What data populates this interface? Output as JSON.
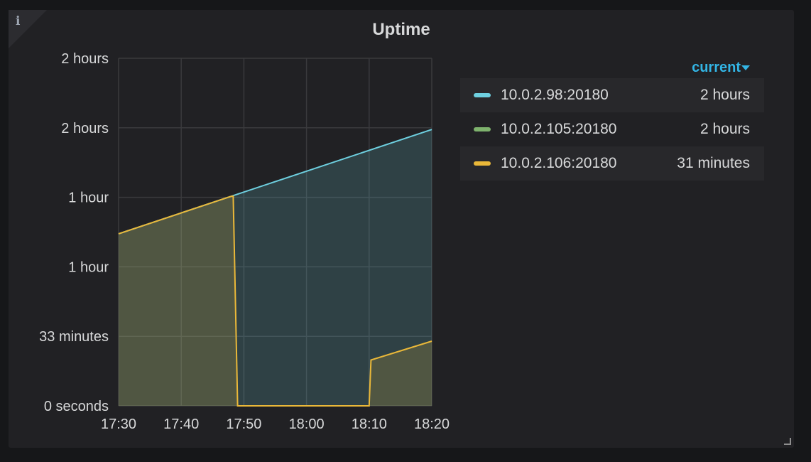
{
  "panel": {
    "title": "Uptime",
    "info_icon": "info-icon"
  },
  "legend": {
    "header": "current",
    "items": [
      {
        "name": "10.0.2.98:20180",
        "value": "2 hours",
        "color": "#6ed0e0"
      },
      {
        "name": "10.0.2.105:20180",
        "value": "2 hours",
        "color": "#7eb26d"
      },
      {
        "name": "10.0.2.106:20180",
        "value": "31 minutes",
        "color": "#eab839"
      }
    ]
  },
  "chart_data": {
    "type": "area",
    "x_unit": "time",
    "x_ticks": [
      "17:30",
      "17:40",
      "17:50",
      "18:00",
      "18:10",
      "18:20"
    ],
    "y_tick_labels": [
      "0 seconds",
      "33 minutes",
      "1 hour",
      "1 hour",
      "2 hours",
      "2 hours"
    ],
    "y_tick_values_sec": [
      0,
      2000,
      4000,
      6000,
      8000,
      10000
    ],
    "ylim": [
      0,
      10000
    ],
    "xlim": [
      "17:30",
      "18:20"
    ],
    "grid": true,
    "legend_position": "right",
    "series": [
      {
        "name": "10.0.2.98:20180",
        "color": "#6ed0e0",
        "x": [
          "17:30",
          "18:20"
        ],
        "y": [
          4950,
          7950
        ]
      },
      {
        "name": "10.0.2.106:20180",
        "color": "#eab839",
        "x": [
          "17:30",
          "17:48",
          "17:48.3",
          "17:49",
          "18:10",
          "18:10.3",
          "18:20"
        ],
        "y": [
          4950,
          6030,
          6030,
          0,
          0,
          1320,
          1860
        ]
      }
    ]
  }
}
